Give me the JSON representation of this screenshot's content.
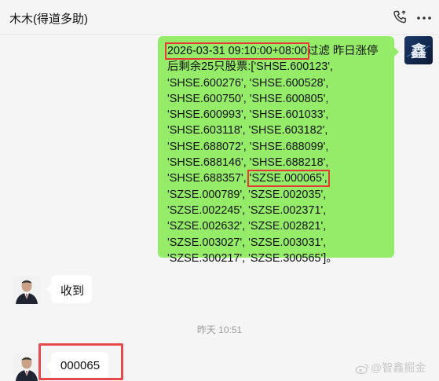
{
  "header": {
    "title": "木木(得道多助)",
    "phone_icon": "phone-icon",
    "more_icon": "more-icon"
  },
  "messages": {
    "sent": {
      "lines": [
        {
          "pre": "",
          "hl": "2026-03-31 09:10:00+08:00",
          "post": "过滤 昨日涨停"
        },
        {
          "pre": "后剩余25只股票:['SHSE.600123',",
          "hl": "",
          "post": ""
        },
        {
          "pre": "'SHSE.600276', 'SHSE.600528',",
          "hl": "",
          "post": ""
        },
        {
          "pre": "'SHSE.600750', 'SHSE.600805',",
          "hl": "",
          "post": ""
        },
        {
          "pre": "'SHSE.600993', 'SHSE.601033',",
          "hl": "",
          "post": ""
        },
        {
          "pre": "'SHSE.603118', 'SHSE.603182',",
          "hl": "",
          "post": ""
        },
        {
          "pre": "'SHSE.688072', 'SHSE.688099',",
          "hl": "",
          "post": ""
        },
        {
          "pre": "'SHSE.688146', 'SHSE.688218',",
          "hl": "",
          "post": ""
        },
        {
          "pre": "'SHSE.688357', ",
          "hl": "'SZSE.000065',",
          "post": ""
        },
        {
          "pre": "'SZSE.000789', 'SZSE.002035',",
          "hl": "",
          "post": ""
        },
        {
          "pre": "'SZSE.002245', 'SZSE.002371',",
          "hl": "",
          "post": ""
        },
        {
          "pre": "'SZSE.002632', 'SZSE.002821',",
          "hl": "",
          "post": ""
        },
        {
          "pre": "'SZSE.003027', 'SZSE.003031',",
          "hl": "",
          "post": ""
        },
        {
          "pre": "'SZSE.300217', 'SZSE.300565']。",
          "hl": "",
          "post": ""
        }
      ],
      "avatar_char": "鑫"
    },
    "received_1": "收到",
    "timestamp": "昨天 10:51",
    "received_2": "000065"
  },
  "watermark": "@智鑫掘金",
  "colors": {
    "sent_bubble": "#95ec69",
    "received_bubble": "#ffffff",
    "highlight_box": "#e5484d",
    "background": "#f5f5f5"
  }
}
